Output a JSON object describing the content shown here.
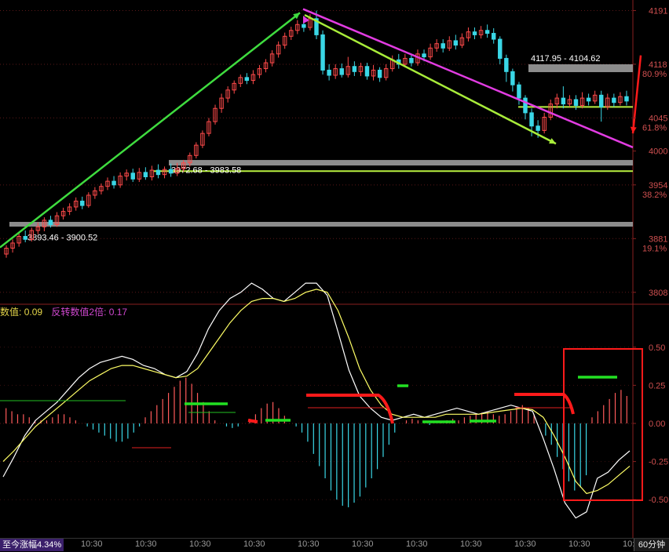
{
  "price_axis": {
    "labels": [
      {
        "text": "4191",
        "value": 4191
      },
      {
        "text": "4118",
        "value": 4118
      },
      {
        "text": "4045",
        "value": 4045
      },
      {
        "text": "4000",
        "value": 4000
      },
      {
        "text": "3954",
        "value": 3954
      },
      {
        "text": "3881",
        "value": 3881
      },
      {
        "text": "3808",
        "value": 3808
      }
    ],
    "fib_labels": [
      {
        "text": "80.9%",
        "value": 4105
      },
      {
        "text": "61.8%",
        "value": 4032
      },
      {
        "text": "38.2%",
        "value": 3941
      },
      {
        "text": "19.1%",
        "value": 3868
      }
    ],
    "grid_values": [
      4191,
      4118,
      4045,
      3954,
      3881,
      3808
    ]
  },
  "zones": [
    {
      "label": "3893.46 - 3900.52",
      "low": 3893.46,
      "high": 3900.52
    },
    {
      "label": "3972.68 - 3983.58",
      "low": 3972.68,
      "high": 3983.58
    },
    {
      "label": "4117.95 - 4104.62",
      "low": 4104.62,
      "high": 4117.95
    }
  ],
  "indicator": {
    "name1": "数值:",
    "value1": "0.09",
    "name2": "反转数值2倍:",
    "value2": "0.17",
    "axis_labels": [
      {
        "text": "0.50",
        "value": 0.5
      },
      {
        "text": "0.25",
        "value": 0.25
      },
      {
        "text": "0.00",
        "value": 0
      },
      {
        "text": "-0.25",
        "value": -0.25
      },
      {
        "text": "-0.50",
        "value": -0.5
      }
    ]
  },
  "time_axis": {
    "ticks": [
      "10:30",
      "10:30",
      "10:30",
      "10:30",
      "10:30",
      "10:30",
      "10:30",
      "10:30",
      "10:30",
      "10:30",
      "10:30",
      "10:30"
    ]
  },
  "status": {
    "change_label": "至今涨幅4.34%",
    "period": "60分钟"
  },
  "colors": {
    "up": "#ff4a4a",
    "down": "#3ad7e6",
    "trend_green": "#3fdc3f",
    "trend_lime": "#a8ec3a",
    "trend_magenta": "#e23ce2",
    "zone_gray": "#8c8c8c",
    "zone_line": "#b8f040",
    "signal_red": "#ff1a1a",
    "dif": "#ffffff",
    "dea": "#ffff66",
    "hist_pos": "#ff5a5a",
    "hist_neg": "#3ad7e6"
  },
  "chart_data": {
    "type": "candlestick",
    "candles": [
      [
        3860,
        3868,
        3855,
        3872
      ],
      [
        3868,
        3875,
        3862,
        3880
      ],
      [
        3875,
        3884,
        3870,
        3889
      ],
      [
        3884,
        3880,
        3876,
        3892
      ],
      [
        3880,
        3892,
        3877,
        3896
      ],
      [
        3892,
        3897,
        3887,
        3903
      ],
      [
        3897,
        3906,
        3891,
        3910
      ],
      [
        3906,
        3900,
        3896,
        3912
      ],
      [
        3900,
        3912,
        3897,
        3917
      ],
      [
        3912,
        3918,
        3907,
        3923
      ],
      [
        3918,
        3924,
        3913,
        3929
      ],
      [
        3924,
        3932,
        3919,
        3937
      ],
      [
        3932,
        3926,
        3921,
        3938
      ],
      [
        3926,
        3940,
        3923,
        3944
      ],
      [
        3940,
        3946,
        3935,
        3951
      ],
      [
        3946,
        3952,
        3941,
        3956
      ],
      [
        3952,
        3959,
        3947,
        3964
      ],
      [
        3959,
        3954,
        3949,
        3966
      ],
      [
        3954,
        3966,
        3950,
        3971
      ],
      [
        3966,
        3970,
        3960,
        3975
      ],
      [
        3970,
        3962,
        3958,
        3976
      ],
      [
        3962,
        3971,
        3958,
        3977
      ],
      [
        3971,
        3965,
        3961,
        3978
      ],
      [
        3965,
        3974,
        3960,
        3980
      ],
      [
        3974,
        3968,
        3963,
        3982
      ],
      [
        3968,
        3975,
        3963,
        3979
      ],
      [
        3975,
        3970,
        3965,
        3983
      ],
      [
        3970,
        3976,
        3966,
        3984
      ],
      [
        3976,
        3984,
        3972,
        3988
      ],
      [
        3984,
        3994,
        3979,
        3998
      ],
      [
        3994,
        4008,
        3990,
        4012
      ],
      [
        4008,
        4024,
        4004,
        4028
      ],
      [
        4024,
        4040,
        4020,
        4045
      ],
      [
        4040,
        4058,
        4036,
        4063
      ],
      [
        4058,
        4072,
        4052,
        4078
      ],
      [
        4072,
        4083,
        4066,
        4088
      ],
      [
        4083,
        4092,
        4078,
        4096
      ],
      [
        4092,
        4100,
        4087,
        4104
      ],
      [
        4100,
        4096,
        4091,
        4106
      ],
      [
        4096,
        4104,
        4091,
        4110
      ],
      [
        4104,
        4112,
        4099,
        4117
      ],
      [
        4112,
        4120,
        4107,
        4125
      ],
      [
        4120,
        4132,
        4115,
        4137
      ],
      [
        4132,
        4144,
        4127,
        4149
      ],
      [
        4144,
        4156,
        4139,
        4161
      ],
      [
        4156,
        4164,
        4151,
        4169
      ],
      [
        4164,
        4172,
        4159,
        4178
      ],
      [
        4172,
        4168,
        4162,
        4182
      ],
      [
        4168,
        4180,
        4164,
        4186
      ],
      [
        4180,
        4158,
        4152,
        4191
      ],
      [
        4158,
        4110,
        4104,
        4164
      ],
      [
        4110,
        4103,
        4096,
        4118
      ],
      [
        4103,
        4112,
        4098,
        4118
      ],
      [
        4112,
        4104,
        4100,
        4119
      ],
      [
        4104,
        4115,
        4100,
        4128
      ],
      [
        4115,
        4108,
        4102,
        4122
      ],
      [
        4108,
        4115,
        4102,
        4120
      ],
      [
        4115,
        4102,
        4097,
        4120
      ],
      [
        4102,
        4110,
        4096,
        4117
      ],
      [
        4110,
        4100,
        4094,
        4114
      ],
      [
        4100,
        4112,
        4096,
        4118
      ],
      [
        4112,
        4124,
        4108,
        4130
      ],
      [
        4124,
        4118,
        4112,
        4132
      ],
      [
        4118,
        4126,
        4114,
        4132
      ],
      [
        4126,
        4120,
        4115,
        4131
      ],
      [
        4120,
        4132,
        4116,
        4138
      ],
      [
        4132,
        4128,
        4122,
        4138
      ],
      [
        4128,
        4140,
        4124,
        4146
      ],
      [
        4140,
        4146,
        4135,
        4152
      ],
      [
        4146,
        4140,
        4134,
        4152
      ],
      [
        4140,
        4150,
        4136,
        4156
      ],
      [
        4150,
        4144,
        4138,
        4158
      ],
      [
        4144,
        4154,
        4140,
        4160
      ],
      [
        4154,
        4162,
        4149,
        4168
      ],
      [
        4162,
        4158,
        4152,
        4168
      ],
      [
        4158,
        4164,
        4153,
        4170
      ],
      [
        4164,
        4160,
        4154,
        4172
      ],
      [
        4160,
        4152,
        4146,
        4167
      ],
      [
        4152,
        4126,
        4118,
        4156
      ],
      [
        4126,
        4108,
        4094,
        4131
      ],
      [
        4108,
        4090,
        4081,
        4112
      ],
      [
        4090,
        4072,
        4063,
        4094
      ],
      [
        4072,
        4052,
        4043,
        4076
      ],
      [
        4052,
        4034,
        4020,
        4058
      ],
      [
        4034,
        4028,
        4018,
        4042
      ],
      [
        4028,
        4046,
        4024,
        4052
      ],
      [
        4046,
        4064,
        4042,
        4070
      ],
      [
        4064,
        4072,
        4058,
        4078
      ],
      [
        4072,
        4064,
        4058,
        4088
      ],
      [
        4064,
        4070,
        4060,
        4076
      ],
      [
        4070,
        4062,
        4056,
        4076
      ],
      [
        4062,
        4072,
        4058,
        4080
      ],
      [
        4072,
        4068,
        4062,
        4078
      ],
      [
        4068,
        4076,
        4064,
        4082
      ],
      [
        4076,
        4060,
        4040,
        4082
      ],
      [
        4060,
        4072,
        4056,
        4078
      ],
      [
        4072,
        4066,
        4060,
        4078
      ],
      [
        4066,
        4074,
        4062,
        4080
      ],
      [
        4074,
        4068,
        4062,
        4082
      ]
    ],
    "macd": {
      "dif": [
        -0.35,
        -0.22,
        -0.08,
        0.02,
        0.08,
        0.14,
        0.22,
        0.3,
        0.36,
        0.4,
        0.42,
        0.44,
        0.42,
        0.38,
        0.36,
        0.32,
        0.3,
        0.34,
        0.46,
        0.62,
        0.74,
        0.82,
        0.86,
        0.92,
        0.88,
        0.82,
        0.8,
        0.86,
        0.92,
        0.92,
        0.84,
        0.6,
        0.35,
        0.18,
        0.1,
        0.04,
        0.02,
        0.04,
        0.06,
        0.04,
        0.06,
        0.08,
        0.1,
        0.08,
        0.06,
        0.08,
        0.1,
        0.12,
        0.1,
        0.08,
        -0.1,
        -0.3,
        -0.52,
        -0.62,
        -0.58,
        -0.36,
        -0.32,
        -0.24,
        -0.18
      ],
      "dea": [
        -0.25,
        -0.18,
        -0.1,
        -0.02,
        0.04,
        0.1,
        0.16,
        0.22,
        0.28,
        0.32,
        0.36,
        0.38,
        0.38,
        0.36,
        0.34,
        0.32,
        0.3,
        0.31,
        0.36,
        0.46,
        0.56,
        0.66,
        0.74,
        0.8,
        0.82,
        0.82,
        0.8,
        0.82,
        0.86,
        0.88,
        0.86,
        0.74,
        0.56,
        0.36,
        0.22,
        0.12,
        0.06,
        0.04,
        0.04,
        0.04,
        0.04,
        0.06,
        0.06,
        0.06,
        0.06,
        0.07,
        0.08,
        0.09,
        0.1,
        0.09,
        0.04,
        -0.08,
        -0.22,
        -0.38,
        -0.46,
        -0.44,
        -0.4,
        -0.34,
        -0.28
      ],
      "hist": [
        0.1,
        0.08,
        0.06,
        0.06,
        0.04,
        0.02,
        0.02,
        0.02,
        0.04,
        0.06,
        0.06,
        0.04,
        0.02,
        0.0,
        -0.02,
        -0.04,
        -0.06,
        -0.08,
        -0.1,
        -0.12,
        -0.12,
        -0.1,
        -0.06,
        -0.02,
        0.04,
        0.08,
        0.12,
        0.16,
        0.2,
        0.24,
        0.28,
        0.3,
        0.26,
        0.2,
        0.14,
        0.08,
        0.02,
        0.0,
        -0.02,
        -0.03,
        -0.02,
        0.0,
        0.03,
        0.06,
        0.1,
        0.13,
        0.14,
        0.1,
        0.05,
        0.0,
        -0.02,
        -0.06,
        -0.12,
        -0.2,
        -0.28,
        -0.36,
        -0.44,
        -0.5,
        -0.54,
        -0.55,
        -0.52,
        -0.48,
        -0.42,
        -0.36,
        -0.3,
        -0.22,
        -0.14,
        -0.06,
        0.0,
        0.02,
        0.03,
        0.02,
        0.0,
        -0.01,
        0.0,
        0.01,
        0.02,
        0.03,
        0.02,
        0.04,
        0.05,
        0.06,
        0.07,
        0.08,
        0.06,
        0.05,
        0.06,
        0.08,
        0.1,
        0.12,
        0.1,
        0.06,
        0.0,
        -0.08,
        -0.14,
        -0.22,
        -0.3,
        -0.38,
        -0.44,
        -0.42,
        -0.34,
        0.04,
        0.08,
        0.12,
        0.16,
        0.2,
        0.22,
        0.18
      ]
    }
  }
}
